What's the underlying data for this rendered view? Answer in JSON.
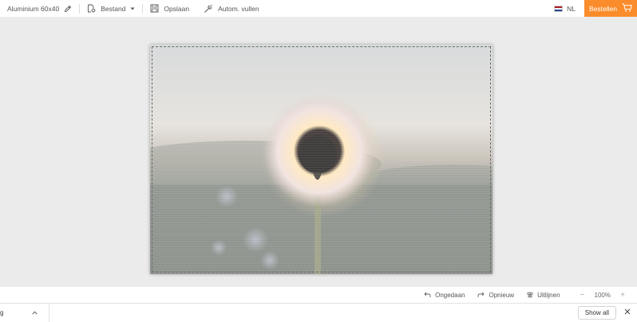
{
  "toolbar": {
    "product_label": "Aluminium 60x40",
    "file_label": "Bestand",
    "save_label": "Opslaan",
    "autofill_label": "Autom. vullen",
    "language_label": "NL",
    "order_label": "Bestellen"
  },
  "bottombar": {
    "undo_label": "Ongedaan",
    "redo_label": "Opnieuw",
    "align_label": "Uitlijnen",
    "zoom_value": "100%",
    "zoom_out_label": "−",
    "zoom_in_label": "+"
  },
  "downloads": {
    "item_name": "g",
    "show_all_label": "Show all"
  },
  "colors": {
    "accent": "#fb8c2b",
    "flag_red": "#ae1c28",
    "flag_white": "#ffffff",
    "flag_blue": "#21468b"
  },
  "icons": {
    "edit": "pencil-icon",
    "file": "file-settings-icon",
    "save": "floppy-disk-icon",
    "autofill": "magic-wand-icon",
    "cart": "shopping-cart-icon",
    "undo": "undo-arrow-icon",
    "redo": "redo-arrow-icon",
    "align": "align-center-icon",
    "close": "close-icon"
  }
}
